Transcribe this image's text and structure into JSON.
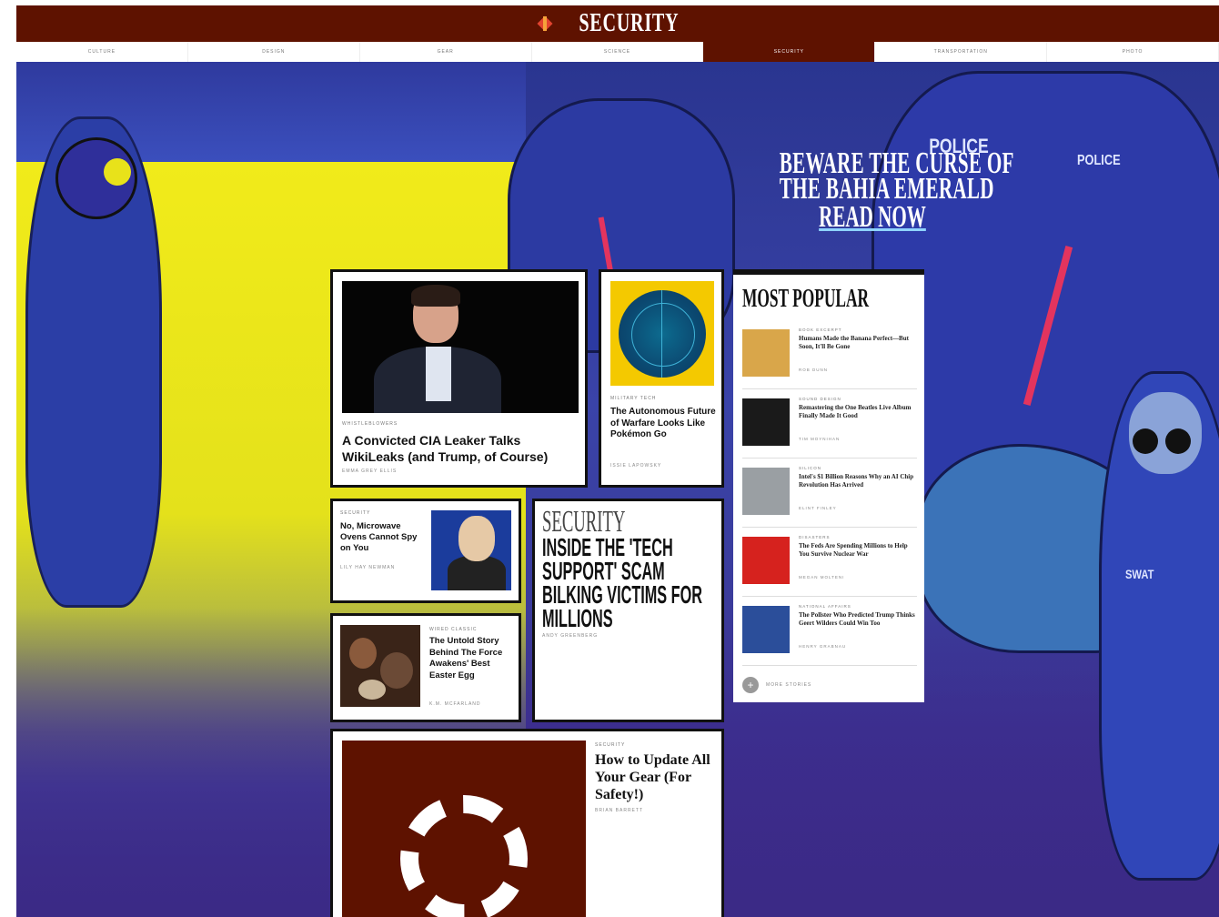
{
  "header": {
    "title": "SECURITY",
    "logo_icon": "wired-flame-icon"
  },
  "nav": [
    "CULTURE",
    "DESIGN",
    "GEAR",
    "SCIENCE",
    "SECURITY",
    "TRANSPORTATION",
    "PHOTO"
  ],
  "nav_active": "SECURITY",
  "hero": {
    "promo_line1": "BEWARE THE CURSE OF",
    "promo_line2": "THE BAHIA EMERALD",
    "cta": "READ NOW",
    "badge_left": "POLICE",
    "badge_right": "POLICE",
    "badge_swat": "SWAT"
  },
  "feature": {
    "kicker": "WHISTLEBLOWERS",
    "headline": "A Convicted CIA Leaker Talks WikiLeaks (and Trump, of Course)",
    "byline": "EMMA GREY ELLIS"
  },
  "side_story": {
    "kicker": "MILITARY TECH",
    "headline": "The Autonomous Future of Warfare Looks Like Pokémon Go",
    "byline": "ISSIE LAPOWSKY"
  },
  "small_story_1": {
    "kicker": "SECURITY",
    "headline": "No, Microwave Ovens Cannot Spy on You",
    "byline": "LILY HAY NEWMAN"
  },
  "small_story_2": {
    "kicker": "WIRED CLASSIC",
    "headline": "The Untold Story Behind The Force Awakens' Best Easter Egg",
    "byline": "K.M. MCFARLAND"
  },
  "section_story": {
    "section": "SECURITY",
    "headline": "INSIDE THE 'TECH SUPPORT' SCAM BILKING VICTIMS FOR MILLIONS",
    "byline": "ANDY GREENBERG"
  },
  "bottom_story": {
    "kicker": "SECURITY",
    "headline": "How to Update All Your Gear (For Safety!)",
    "byline": "BRIAN BARRETT"
  },
  "most_popular": {
    "title": "MOST POPULAR",
    "items": [
      {
        "kicker": "BOOK EXCERPT",
        "headline": "Humans Made the Banana Perfect—But Soon, It'll Be Gone",
        "byline": "ROB DUNN",
        "thumb_color": "#d9a64a"
      },
      {
        "kicker": "SOUND DESIGN",
        "headline": "Remastering the One Beatles Live Album Finally Made It Good",
        "byline": "TIM MOYNIHAN",
        "thumb_color": "#1a1a1a"
      },
      {
        "kicker": "SILICON",
        "headline": "Intel's $1 Billion Reasons Why an AI Chip Revolution Has Arrived",
        "byline": "ELINT FINLEY",
        "thumb_color": "#9a9fa3"
      },
      {
        "kicker": "DISASTERS",
        "headline": "The Feds Are Spending Millions to Help You Survive Nuclear War",
        "byline": "MEGAN MOLTENI",
        "thumb_color": "#d6221e"
      },
      {
        "kicker": "NATIONAL AFFAIRS",
        "headline": "The Pollster Who Predicted Trump Thinks Geert Wilders Could Win Too",
        "byline": "HENRY GRABNAU",
        "thumb_color": "#2b4e9a"
      }
    ],
    "more_label": "MORE STORIES"
  }
}
